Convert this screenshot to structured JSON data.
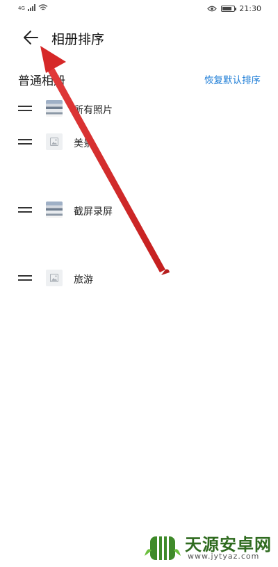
{
  "status_bar": {
    "network_label": "4G",
    "time": "21:30",
    "battery_level_percent": 80
  },
  "header": {
    "title": "相册排序"
  },
  "section": {
    "title": "普通相册",
    "restore_label": "恢复默认排序"
  },
  "albums": [
    {
      "label": "所有照片",
      "thumb": "photo"
    },
    {
      "label": "美景",
      "thumb": "placeholder"
    },
    {
      "label": "截屏录屏",
      "thumb": "photo"
    },
    {
      "label": "旅游",
      "thumb": "placeholder"
    }
  ],
  "watermark": {
    "title": "天源安卓网",
    "url": "www.jytyaz.com"
  },
  "colors": {
    "link": "#1a7bd6",
    "annotation_arrow": "#d62828",
    "watermark_green": "#2f6b1f"
  }
}
